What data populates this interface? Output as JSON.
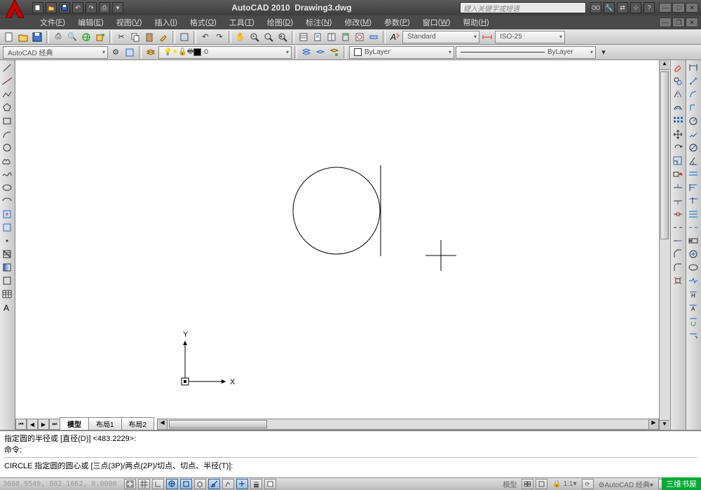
{
  "title": {
    "app": "AutoCAD 2010",
    "file": "Drawing3.dwg"
  },
  "search": {
    "placeholder": "键入关键字或短语"
  },
  "menu": [
    {
      "label": "文件",
      "key": "F"
    },
    {
      "label": "编辑",
      "key": "E"
    },
    {
      "label": "视图",
      "key": "V"
    },
    {
      "label": "插入",
      "key": "I"
    },
    {
      "label": "格式",
      "key": "O"
    },
    {
      "label": "工具",
      "key": "T"
    },
    {
      "label": "绘图",
      "key": "D"
    },
    {
      "label": "标注",
      "key": "N"
    },
    {
      "label": "修改",
      "key": "M"
    },
    {
      "label": "参数",
      "key": "P"
    },
    {
      "label": "窗口",
      "key": "W"
    },
    {
      "label": "帮助",
      "key": "H"
    }
  ],
  "workspace": {
    "name": "AutoCAD 经典"
  },
  "layer": {
    "name": "0"
  },
  "textstyle": {
    "name": "Standard"
  },
  "dimstyle": {
    "name": "ISO-25"
  },
  "bylayer": {
    "color": "ByLayer",
    "ltype": "ByLayer"
  },
  "tabs": {
    "model": "模型",
    "layout1": "布局1",
    "layout2": "布局2"
  },
  "cmd": {
    "line1": "指定圆的半径或 [直径(D)] <483.2229>:",
    "line2": "命令:",
    "line3": "CIRCLE 指定圆的圆心或 [三点(3P)/两点(2P)/切点、切点、半径(T)]:"
  },
  "status": {
    "coords": "3608.9549, 802.1062, 0.0000",
    "scale": "1:1",
    "ws": "AutoCAD 经典"
  },
  "ucs": {
    "x": "X",
    "y": "Y"
  },
  "watermark": "三维书屋"
}
